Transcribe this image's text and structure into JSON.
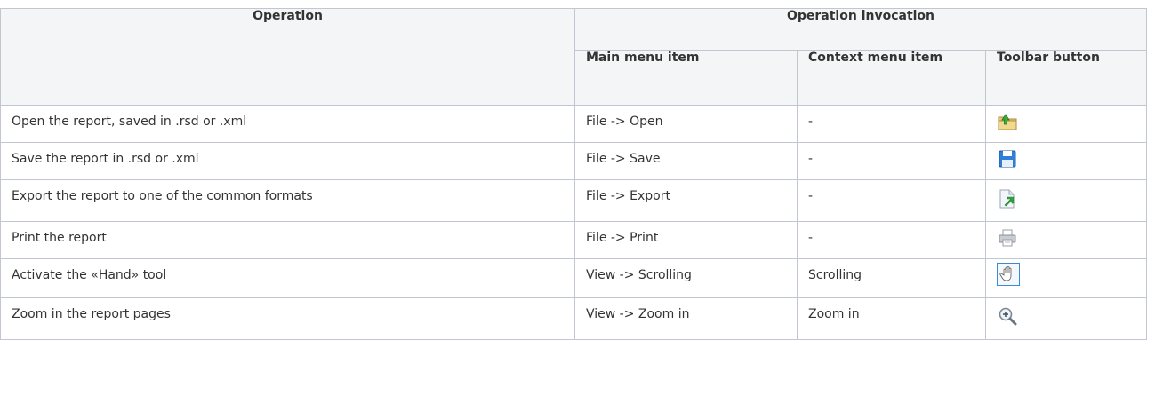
{
  "table": {
    "header": {
      "operation": "Operation",
      "invocation": "Operation invocation",
      "main_menu": "Main menu item",
      "context_menu": "Context menu item",
      "toolbar_button": "Toolbar button"
    },
    "rows": [
      {
        "operation": "Open the report, saved in .rsd or .xml",
        "main_menu": "File -> Open",
        "context_menu": "-",
        "icon": "open-folder-icon"
      },
      {
        "operation": "Save the report in .rsd or .xml",
        "main_menu": "File -> Save",
        "context_menu": "-",
        "icon": "save-disk-icon"
      },
      {
        "operation": "Export the report to one of the common formats",
        "main_menu": "File -> Export",
        "context_menu": "-",
        "icon": "export-document-icon"
      },
      {
        "operation": "Print the report",
        "main_menu": "File -> Print",
        "context_menu": "-",
        "icon": "printer-icon"
      },
      {
        "operation": "Activate the «Hand» tool",
        "main_menu": "View -> Scrolling",
        "context_menu": "Scrolling",
        "icon": "hand-icon"
      },
      {
        "operation": "Zoom in the report pages",
        "main_menu": "View -> Zoom in",
        "context_menu": "Zoom in",
        "icon": "zoom-in-icon"
      }
    ]
  }
}
